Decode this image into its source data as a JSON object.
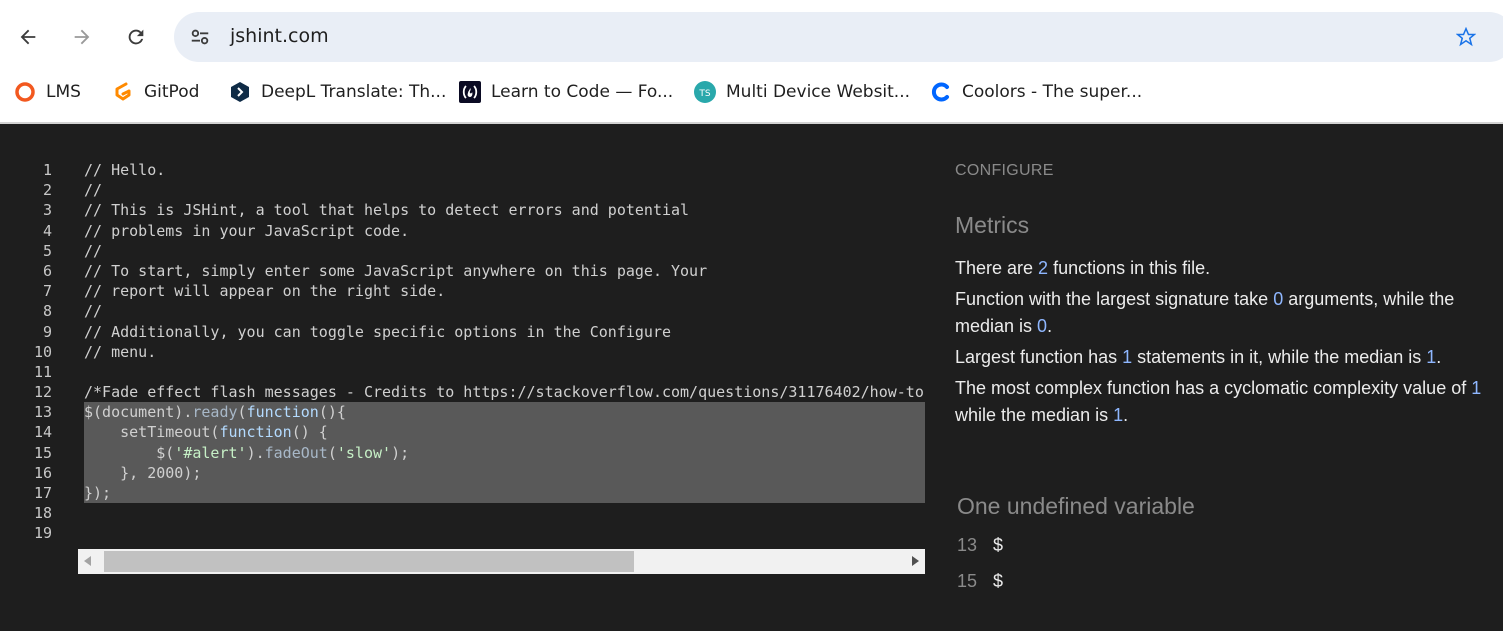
{
  "browser": {
    "url": "jshint.com",
    "bookmarks": [
      {
        "label": "LMS",
        "icon": "lms-ring-icon"
      },
      {
        "label": "GitPod",
        "icon": "gitpod-icon"
      },
      {
        "label": "DeepL Translate: Th...",
        "icon": "deepl-icon"
      },
      {
        "label": "Learn to Code — Fo...",
        "icon": "freecodecamp-icon"
      },
      {
        "label": "Multi Device Websit...",
        "icon": "ts-icon"
      },
      {
        "label": "Coolors - The super...",
        "icon": "coolors-icon"
      }
    ]
  },
  "editor": {
    "line_numbers": [
      "1",
      "2",
      "3",
      "4",
      "5",
      "6",
      "7",
      "8",
      "9",
      "10",
      "11",
      "12",
      "13",
      "14",
      "15",
      "16",
      "17",
      "18",
      "19"
    ],
    "lines": [
      "// Hello.",
      "//",
      "// This is JSHint, a tool that helps to detect errors and potential",
      "// problems in your JavaScript code.",
      "//",
      "// To start, simply enter some JavaScript anywhere on this page. Your",
      "// report will appear on the right side.",
      "//",
      "// Additionally, you can toggle specific options in the Configure",
      "// menu.",
      "",
      "/*Fade effect flash messages - Credits to https://stackoverflow.com/questions/31176402/how-to-",
      "$(document).ready(function(){",
      "    setTimeout(function() {",
      "        $('#alert').fadeOut('slow');",
      "    }, 2000);",
      "});",
      "",
      ""
    ],
    "selected_lines": [
      13,
      14,
      15,
      16,
      17
    ]
  },
  "report": {
    "configure_label": "CONFIGURE",
    "metrics_title": "Metrics",
    "metrics": {
      "functions_pre": "There are ",
      "functions_count": "2",
      "functions_post": " functions in this file.",
      "signature_pre": "Function with the largest signature take ",
      "signature_max": "0",
      "signature_mid": " arguments, while the median is ",
      "signature_median": "0",
      "signature_post": ".",
      "statements_pre": "Largest function has ",
      "statements_max": "1",
      "statements_mid": " statements in it, while the median is ",
      "statements_median": "1",
      "statements_post": ".",
      "complexity_pre": "The most complex function has a cyclomatic complexity value of ",
      "complexity_max": "1",
      "complexity_mid": " while the median is ",
      "complexity_median": "1",
      "complexity_post": "."
    },
    "undefined_title": "One undefined variable",
    "undefined": [
      {
        "line": "13",
        "name": "$"
      },
      {
        "line": "15",
        "name": "$"
      }
    ]
  },
  "colors": {
    "background": "#1e1e1e",
    "selection": "#595959",
    "metric_number": "#8fb7ff",
    "muted_text": "#8a8a8a"
  }
}
